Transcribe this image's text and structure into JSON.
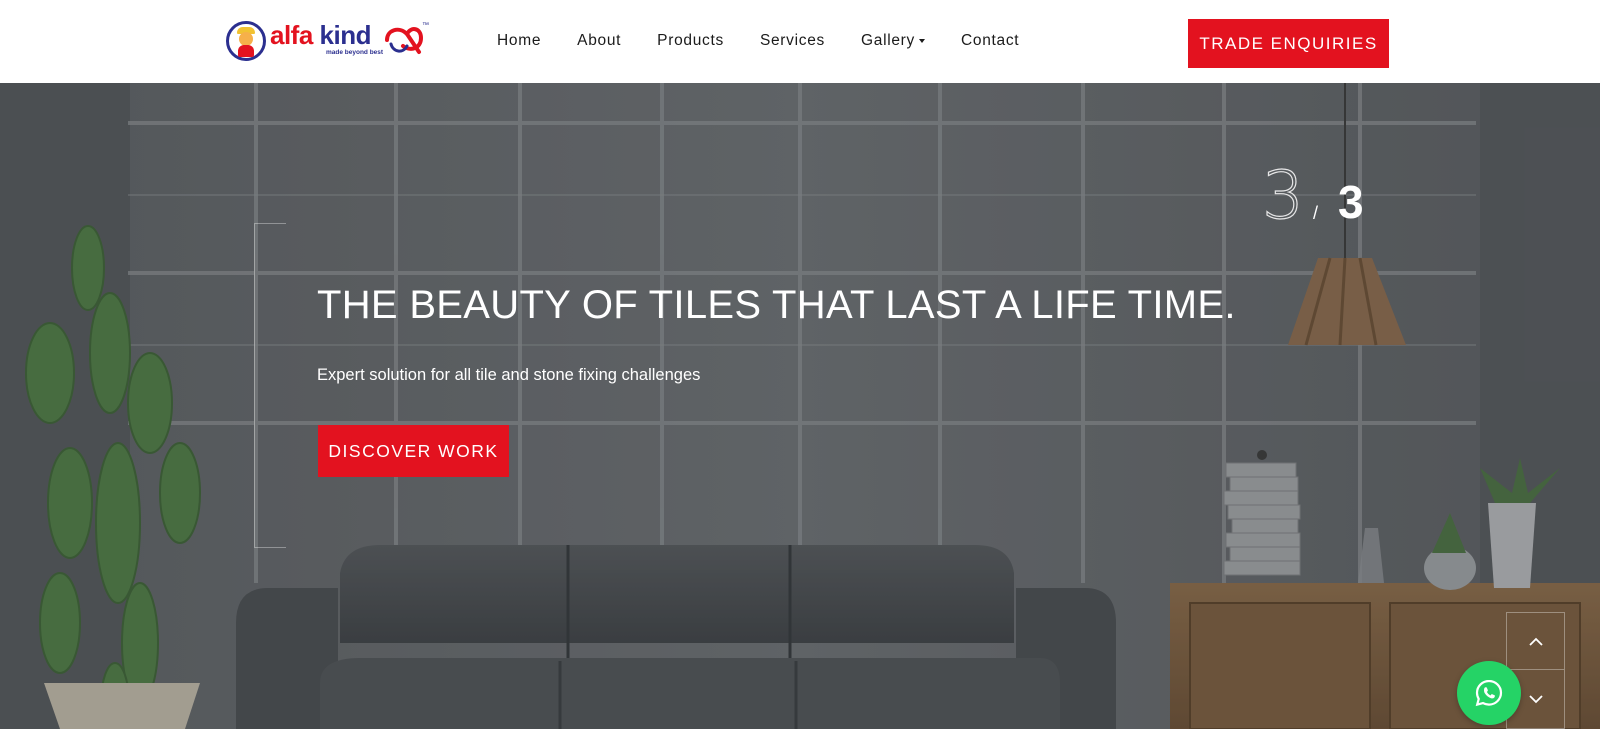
{
  "brand": {
    "name_part1": "alfa",
    "name_part2": "kind",
    "tagline": "made beyond best",
    "trademark": "™",
    "primary_color": "#e3121f",
    "secondary_color": "#2b2f8f"
  },
  "nav": {
    "items": [
      {
        "label": "Home",
        "has_dropdown": false
      },
      {
        "label": "About",
        "has_dropdown": false
      },
      {
        "label": "Products",
        "has_dropdown": false
      },
      {
        "label": "Services",
        "has_dropdown": false
      },
      {
        "label": "Gallery",
        "has_dropdown": true
      },
      {
        "label": "Contact",
        "has_dropdown": false
      }
    ],
    "cta_label": "TRADE ENQUIRIES"
  },
  "hero": {
    "title": "THE BEAUTY OF TILES THAT LAST A LIFE TIME.",
    "subtitle": "Expert solution for all tile and stone fixing challenges",
    "cta_label": "DISCOVER WORK",
    "slide_current": "3",
    "slide_separator": "/",
    "slide_total": "3"
  },
  "controls": {
    "scroll_up_icon": "chevron-up-icon",
    "scroll_down_icon": "chevron-down-icon",
    "whatsapp_icon": "whatsapp-icon",
    "whatsapp_color": "#25d366"
  }
}
